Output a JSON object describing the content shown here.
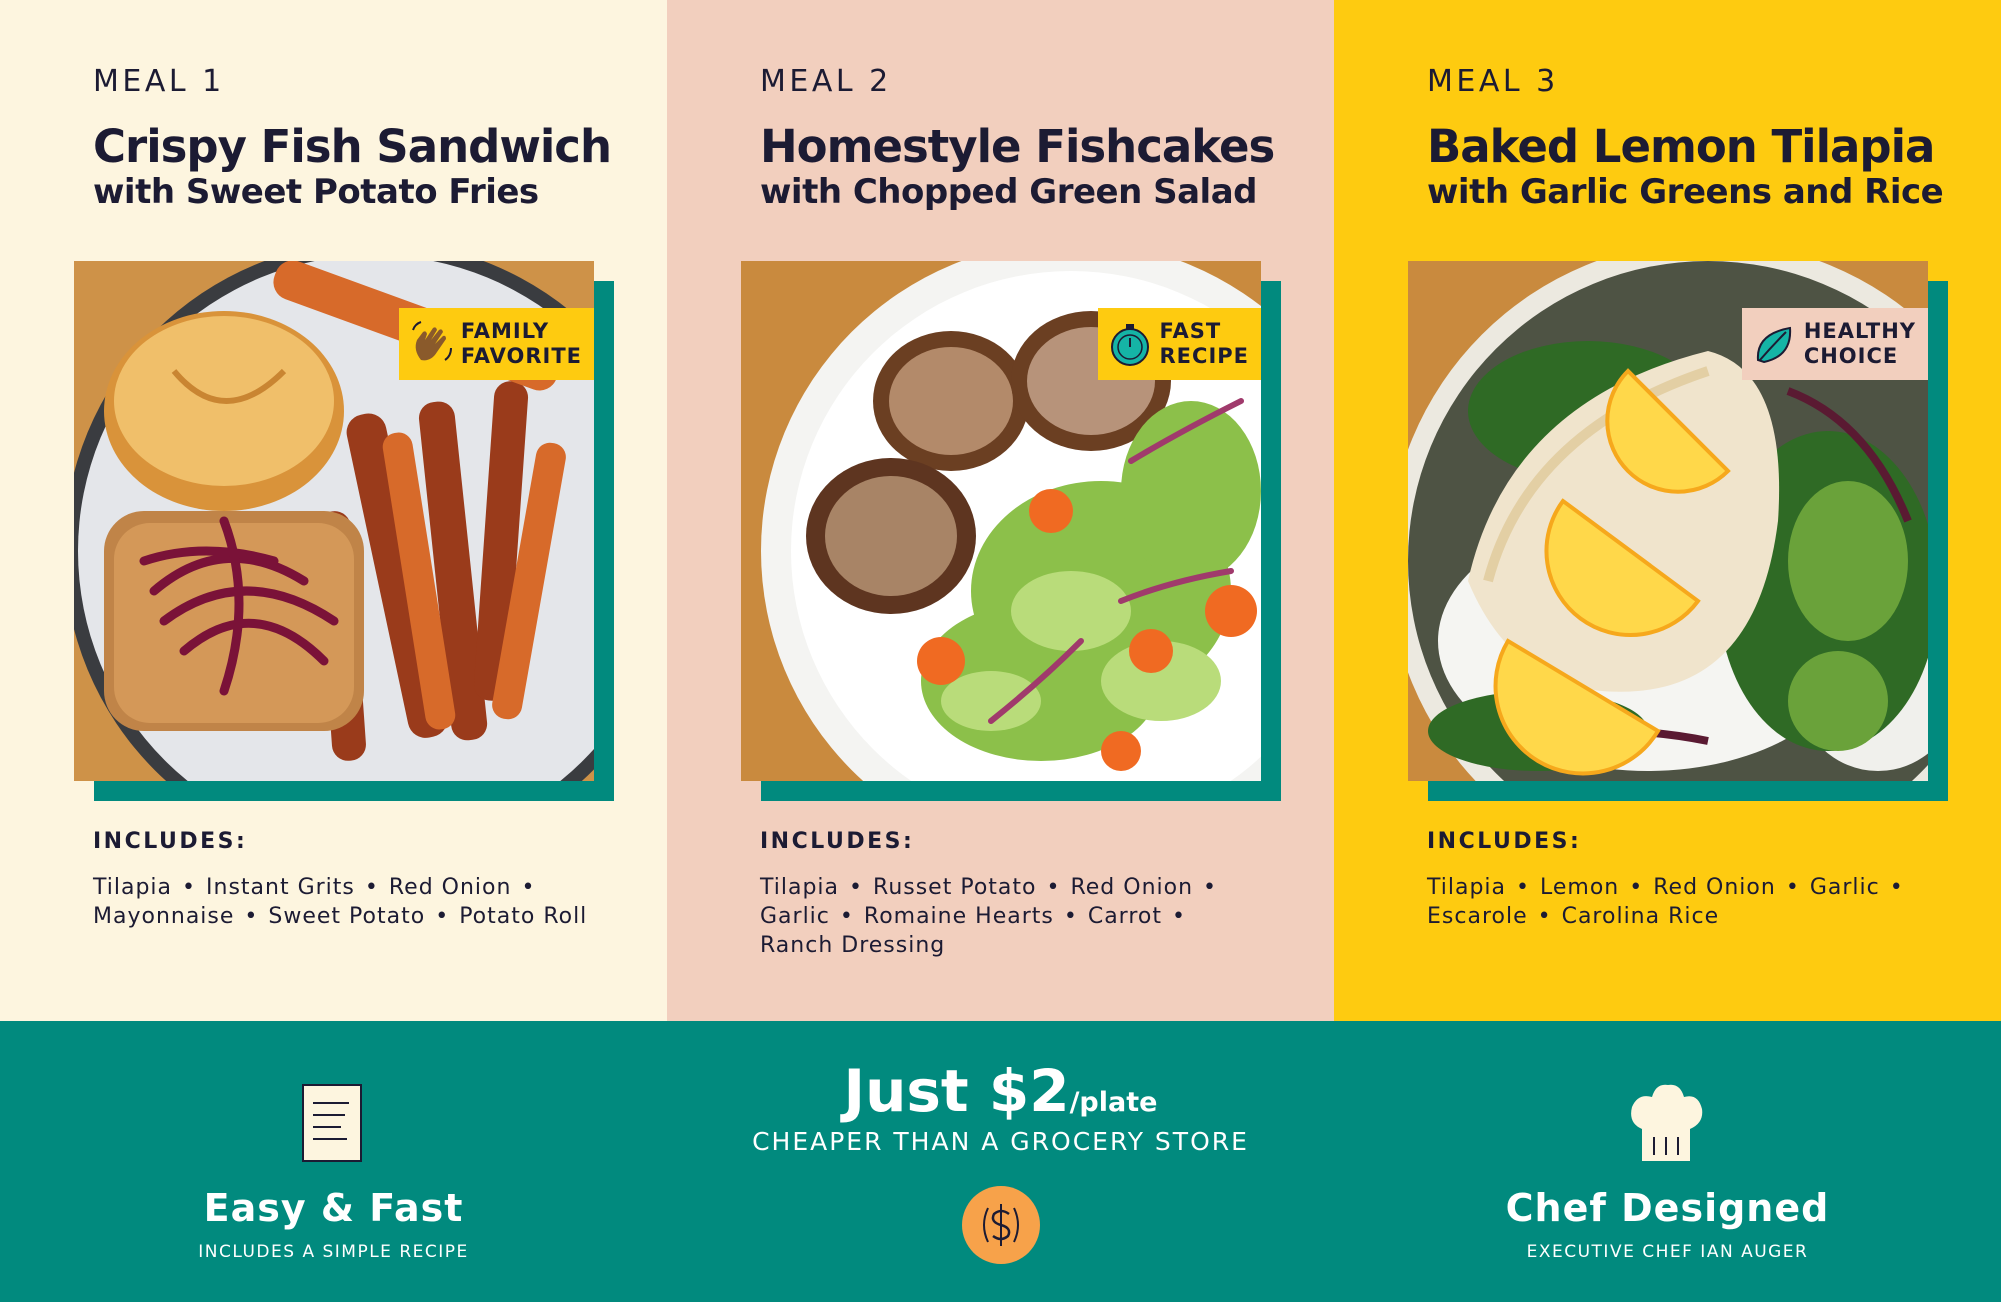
{
  "colors": {
    "panel_1": "#fdf5df",
    "panel_2": "#f2cfbe",
    "panel_3": "#fecb10",
    "teal": "#018a7e",
    "ink": "#1c1b33"
  },
  "meals": [
    {
      "label": "MEAL 1",
      "title": "Crispy Fish Sandwich",
      "subtitle": "with Sweet Potato Fries",
      "badge": {
        "icon": "waving-hand-icon",
        "line1": "FAMILY",
        "line2": "FAVORITE",
        "color": "#fecb10"
      },
      "includes_label": "INCLUDES:",
      "ingredients": [
        "Tilapia",
        "Instant Grits",
        "Red Onion",
        "Mayonnaise",
        "Sweet Potato",
        "Potato Roll"
      ]
    },
    {
      "label": "MEAL 2",
      "title": "Homestyle Fishcakes",
      "subtitle": "with Chopped Green Salad",
      "badge": {
        "icon": "stopwatch-icon",
        "line1": "FAST",
        "line2": "RECIPE",
        "color": "#fecb10"
      },
      "includes_label": "INCLUDES:",
      "ingredients": [
        "Tilapia",
        "Russet Potato",
        "Red Onion",
        "Garlic",
        "Romaine Hearts",
        "Carrot",
        "Ranch Dressing"
      ]
    },
    {
      "label": "MEAL 3",
      "title": "Baked Lemon Tilapia",
      "subtitle": "with Garlic Greens and Rice",
      "badge": {
        "icon": "leaf-icon",
        "line1": "HEALTHY",
        "line2": "CHOICE",
        "color": "#f2cfbe"
      },
      "includes_label": "INCLUDES:",
      "ingredients": [
        "Tilapia",
        "Lemon",
        "Red Onion",
        "Garlic",
        "Escarole",
        "Carolina Rice"
      ]
    }
  ],
  "footer": {
    "easy": {
      "icon": "recipe-card-icon",
      "title": "Easy & Fast",
      "subtitle": "INCLUDES A SIMPLE RECIPE"
    },
    "price": {
      "main": "Just $2",
      "unit": "/plate",
      "subtitle": "CHEAPER THAN A GROCERY STORE",
      "icon": "dollar-coin-icon"
    },
    "chef": {
      "icon": "chef-hat-icon",
      "title": "Chef Designed",
      "subtitle": "EXECUTIVE CHEF IAN AUGER"
    }
  },
  "separator": "•"
}
